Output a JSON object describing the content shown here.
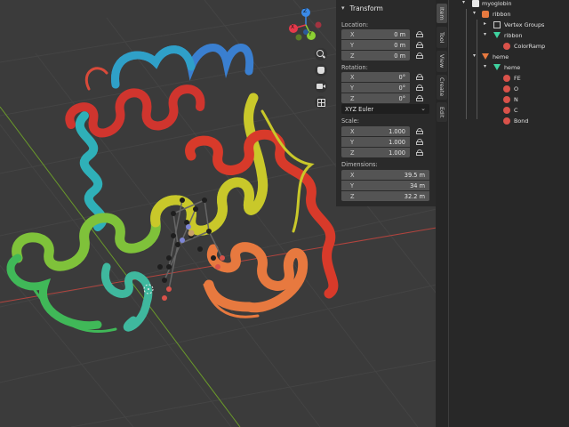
{
  "panel": {
    "title": "Transform",
    "location_label": "Location:",
    "location": [
      {
        "axis": "X",
        "value": "0 m"
      },
      {
        "axis": "Y",
        "value": "0 m"
      },
      {
        "axis": "Z",
        "value": "0 m"
      }
    ],
    "rotation_label": "Rotation:",
    "rotation": [
      {
        "axis": "X",
        "value": "0°"
      },
      {
        "axis": "Y",
        "value": "0°"
      },
      {
        "axis": "Z",
        "value": "0°"
      }
    ],
    "rotation_mode": "XYZ Euler",
    "scale_label": "Scale:",
    "scale": [
      {
        "axis": "X",
        "value": "1.000"
      },
      {
        "axis": "Y",
        "value": "1.000"
      },
      {
        "axis": "Z",
        "value": "1.000"
      }
    ],
    "dimensions_label": "Dimensions:",
    "dimensions": [
      {
        "axis": "X",
        "value": "39.5 m"
      },
      {
        "axis": "Y",
        "value": "34 m"
      },
      {
        "axis": "Z",
        "value": "32.2 m"
      }
    ]
  },
  "tabs": [
    "Item",
    "Tool",
    "View",
    "Create",
    "Edit"
  ],
  "gizmo": {
    "x": "X",
    "y": "Y",
    "z": "Z"
  },
  "outliner": {
    "items": [
      {
        "label": "myoglobin",
        "icon": "collection-icon"
      },
      {
        "label": "ribbon",
        "icon": "object-icon"
      },
      {
        "label": "Vertex Groups",
        "icon": "vertex-groups-icon"
      },
      {
        "label": "ribbon",
        "icon": "mesh-data-icon"
      },
      {
        "label": "ColorRamp",
        "icon": "material-icon"
      },
      {
        "label": "heme",
        "icon": "object-icon"
      },
      {
        "label": "heme",
        "icon": "mesh-data-icon"
      },
      {
        "label": "FE",
        "icon": "material-icon"
      },
      {
        "label": "O",
        "icon": "material-icon"
      },
      {
        "label": "N",
        "icon": "material-icon"
      },
      {
        "label": "C",
        "icon": "material-icon"
      },
      {
        "label": "Bond",
        "icon": "material-icon"
      }
    ]
  },
  "colors": {
    "viewport_bg": "#3b3b3b",
    "grid": "#444444",
    "axis_x": "#c0463f",
    "axis_y": "#6a9a2a",
    "gizmo_x": "#e6394b",
    "gizmo_y": "#8cd033",
    "gizmo_z": "#3a8ae8",
    "accent_orange": "#e7793f"
  }
}
